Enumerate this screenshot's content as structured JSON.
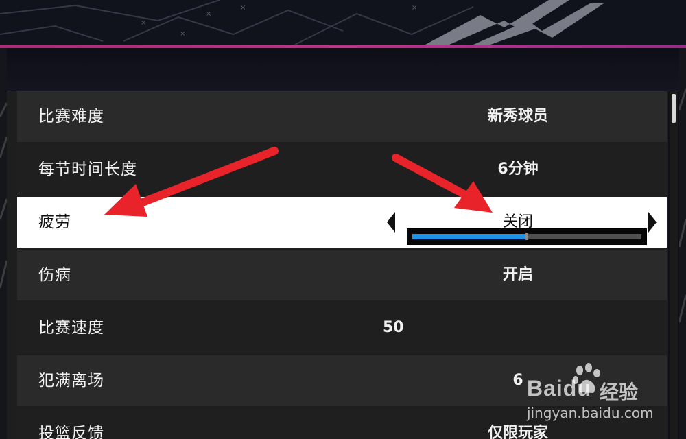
{
  "settings": {
    "rows": [
      {
        "label": "比赛难度",
        "value": "新秀球员"
      },
      {
        "label": "每节时间长度",
        "value": "6分钟"
      },
      {
        "label": "疲劳",
        "value": "关闭"
      },
      {
        "label": "伤病",
        "value": "开启"
      },
      {
        "label": "比赛速度",
        "value": "50"
      },
      {
        "label": "犯满离场",
        "value": "6"
      },
      {
        "label": "投篮反馈",
        "value": "仅限玩家"
      }
    ],
    "speed_slider_level": 0.5
  },
  "colors": {
    "banner_accent": "#c0338a",
    "slider_fill": "#1f93e4",
    "annotation_arrow": "#e8232a",
    "selected_row": "#ffffff"
  },
  "icons": {
    "prev": "caret-left-icon",
    "next": "caret-right-icon"
  },
  "watermark": {
    "brand": "Baidu",
    "product": "经验",
    "url": "jingyan.baidu.com"
  }
}
